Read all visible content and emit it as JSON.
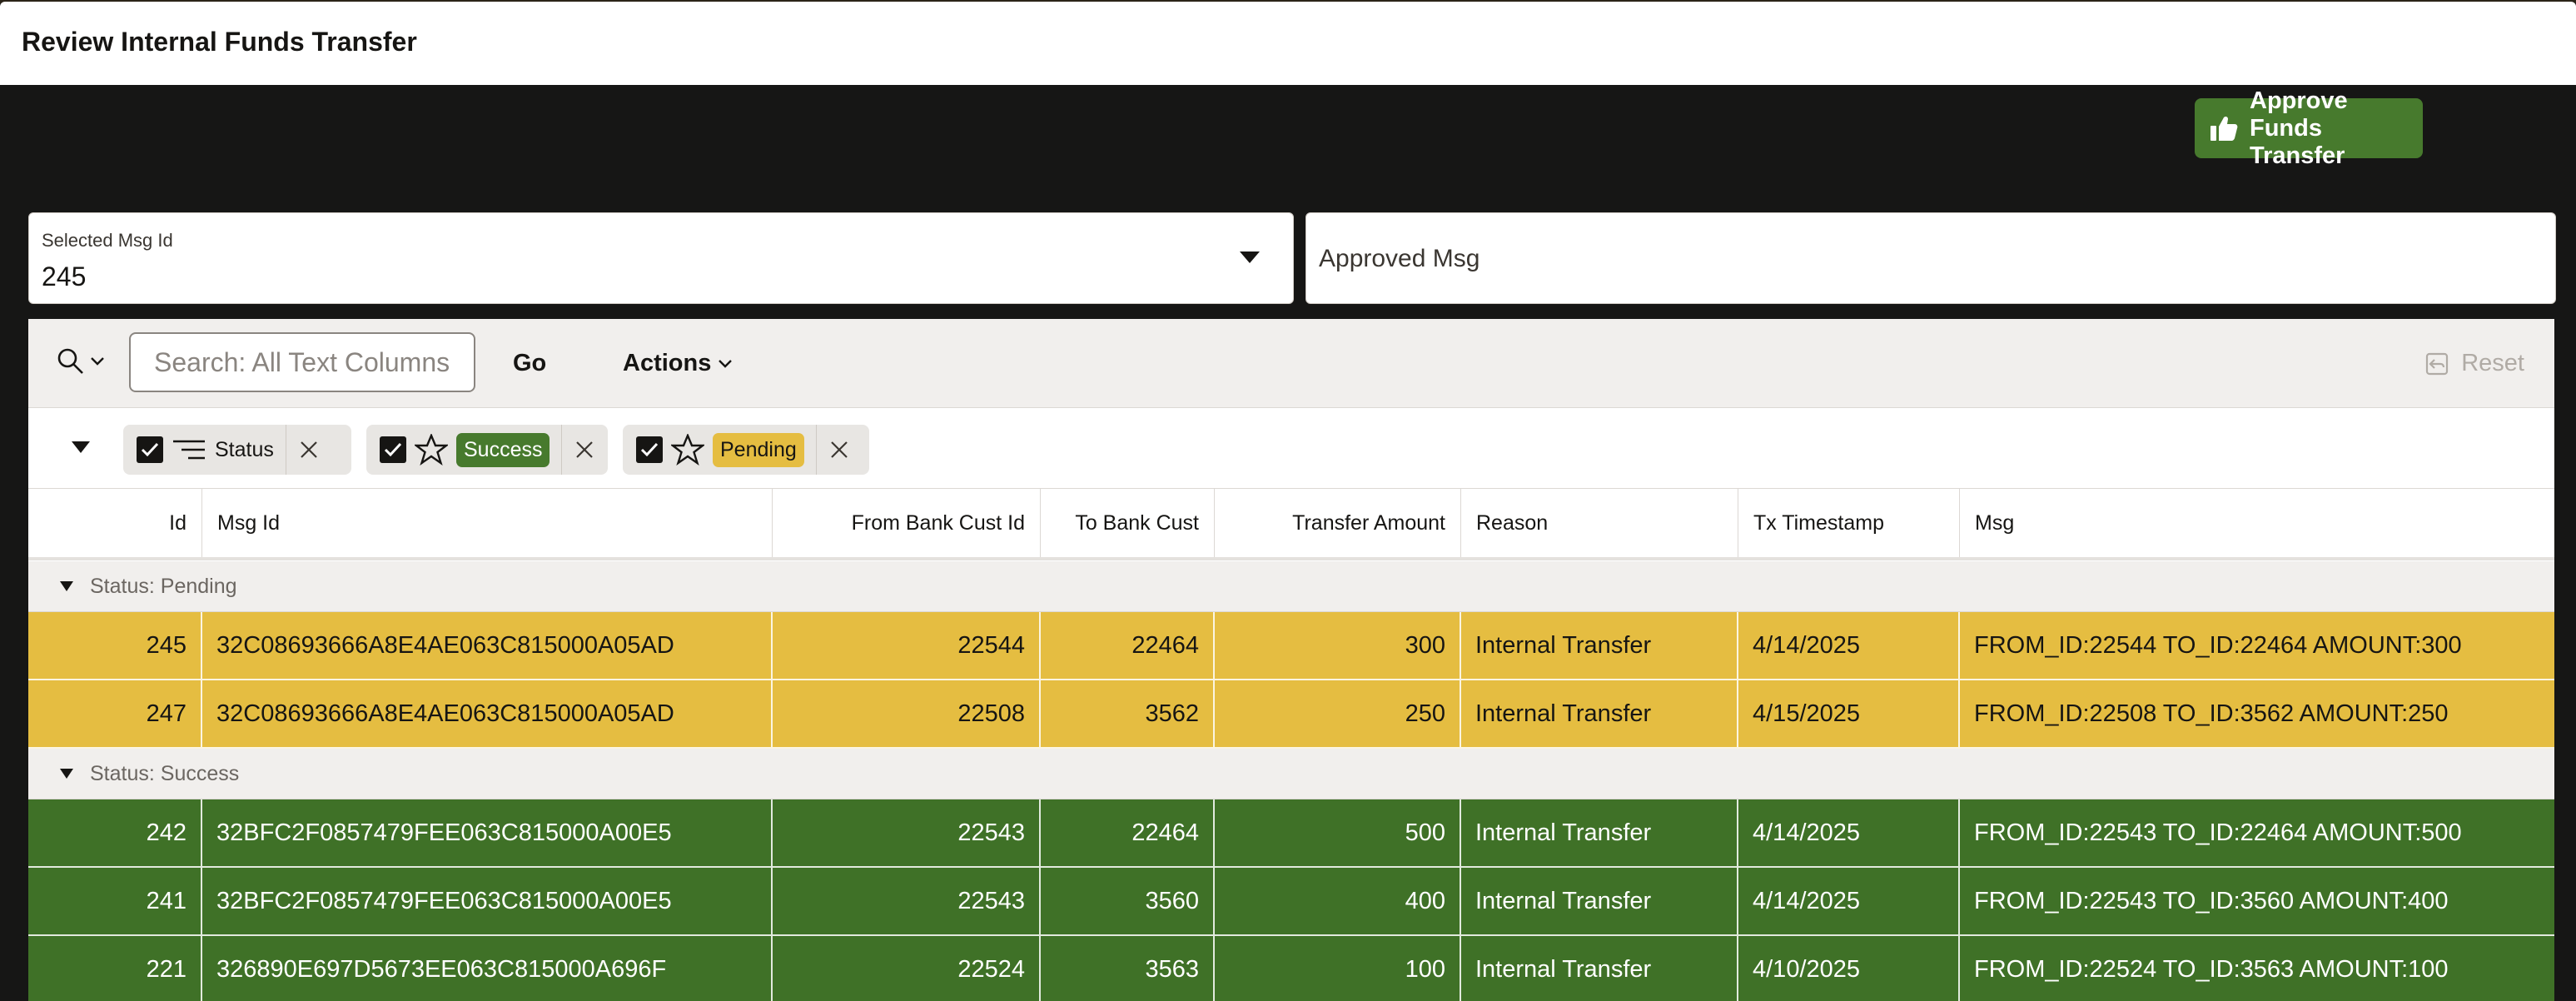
{
  "page": {
    "title": "Review Internal Funds Transfer"
  },
  "toolbar": {
    "approve_label": "Approve Funds Transfer"
  },
  "fields": {
    "selected_msg_id": {
      "label": "Selected Msg Id",
      "value": "245"
    },
    "approved_msg": {
      "label": "Approved Msg",
      "value": ""
    }
  },
  "report": {
    "search_placeholder": "Search: All Text Columns",
    "go_label": "Go",
    "actions_label": "Actions",
    "reset_label": "Reset",
    "filters": [
      {
        "label": "Status",
        "type": "control-break"
      },
      {
        "label": "Success",
        "type": "highlight",
        "color": "#477a2d"
      },
      {
        "label": "Pending",
        "type": "highlight",
        "color": "#e5bd41"
      }
    ],
    "columns": [
      "Id",
      "Msg Id",
      "From Bank Cust Id",
      "To Bank Cust Id",
      "Transfer Amount",
      "Reason",
      "Tx Timestamp",
      "Msg"
    ],
    "groups": [
      {
        "label": "Status: Pending",
        "status": "pending",
        "rows": [
          [
            "245",
            "32C08693666A8E4AE063C815000A05AD",
            "22544",
            "22464",
            "300",
            "Internal Transfer",
            "4/14/2025",
            "FROM_ID:22544 TO_ID:22464 AMOUNT:300"
          ],
          [
            "247",
            "32C08693666A8E4AE063C815000A05AD",
            "22508",
            "3562",
            "250",
            "Internal Transfer",
            "4/15/2025",
            "FROM_ID:22508 TO_ID:3562 AMOUNT:250"
          ]
        ]
      },
      {
        "label": "Status: Success",
        "status": "success",
        "rows": [
          [
            "242",
            "32BFC2F0857479FEE063C815000A00E5",
            "22543",
            "22464",
            "500",
            "Internal Transfer",
            "4/14/2025",
            "FROM_ID:22543 TO_ID:22464 AMOUNT:500"
          ],
          [
            "241",
            "32BFC2F0857479FEE063C815000A00E5",
            "22543",
            "3560",
            "400",
            "Internal Transfer",
            "4/14/2025",
            "FROM_ID:22543 TO_ID:3560 AMOUNT:400"
          ],
          [
            "221",
            "326890E697D5673EE063C815000A696F",
            "22524",
            "3563",
            "100",
            "Internal Transfer",
            "4/10/2025",
            "FROM_ID:22524 TO_ID:3563 AMOUNT:100"
          ]
        ]
      }
    ]
  },
  "colors": {
    "pending": "#e5bd41",
    "success": "#3f7127",
    "approve_button": "#477a2d"
  },
  "icons": {
    "approve": "thumbs-up-icon",
    "search": "search-icon",
    "filter_control_break": "control-break-icon",
    "filter_highlight": "star-icon",
    "remove": "close-icon",
    "reset": "reset-icon"
  }
}
